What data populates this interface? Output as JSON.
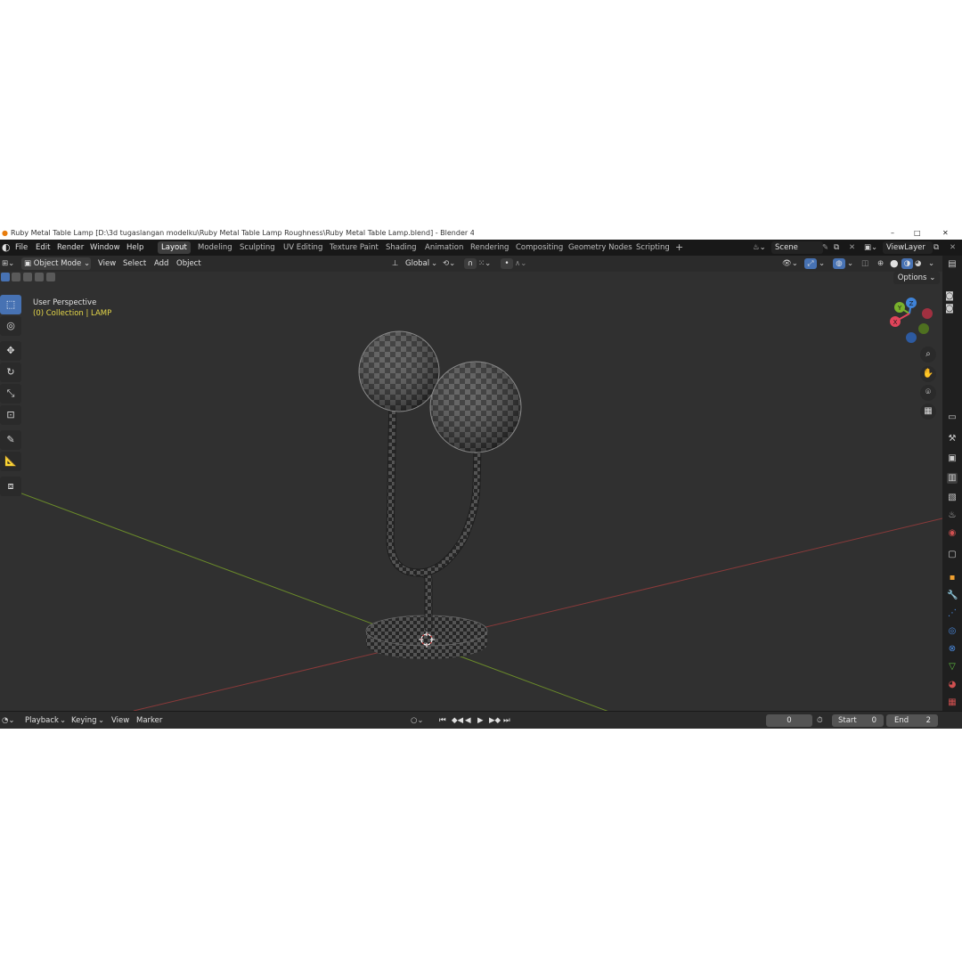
{
  "window": {
    "title": "Ruby Metal Table Lamp [D:\\3d tugaslangan modelku\\Ruby Metal Table Lamp Roughness\\Ruby Metal Table Lamp.blend] - Blender 4.2",
    "controls": [
      "–",
      "□",
      "✕"
    ]
  },
  "topbar": {
    "menus": [
      "File",
      "Edit",
      "Render",
      "Window",
      "Help"
    ],
    "workspaces": [
      "Layout",
      "Modeling",
      "Sculpting",
      "UV Editing",
      "Texture Paint",
      "Shading",
      "Animation",
      "Rendering",
      "Compositing",
      "Geometry Nodes",
      "Scripting"
    ],
    "active_workspace": "Layout",
    "add_workspace": "+",
    "scene": "Scene",
    "view_layer": "ViewLayer"
  },
  "viewport_header": {
    "mode": "Object Mode",
    "menus": [
      "View",
      "Select",
      "Add",
      "Object"
    ],
    "transform_orientation": "Global",
    "options": "Options"
  },
  "viewport": {
    "perspective_label": "User Perspective",
    "collection_label": "(0) Collection | LAMP",
    "gizmo_axes": [
      "Y",
      "Z",
      "X"
    ],
    "accent_collection_color": "#e6d84a",
    "axis_colors": {
      "x": "#e0445a",
      "y": "#79b12c",
      "z": "#3f83d8"
    }
  },
  "toolbar": {
    "tools": [
      "select-box",
      "cursor",
      "move",
      "rotate",
      "scale",
      "transform",
      "annotate",
      "measure",
      "add-cube"
    ],
    "active_tool": "select-box"
  },
  "timeline": {
    "menus": [
      "Playback",
      "Keying",
      "View",
      "Marker"
    ],
    "current_frame": "0",
    "start_label": "Start",
    "start_value": "0",
    "end_label": "End",
    "end_value": "2"
  }
}
